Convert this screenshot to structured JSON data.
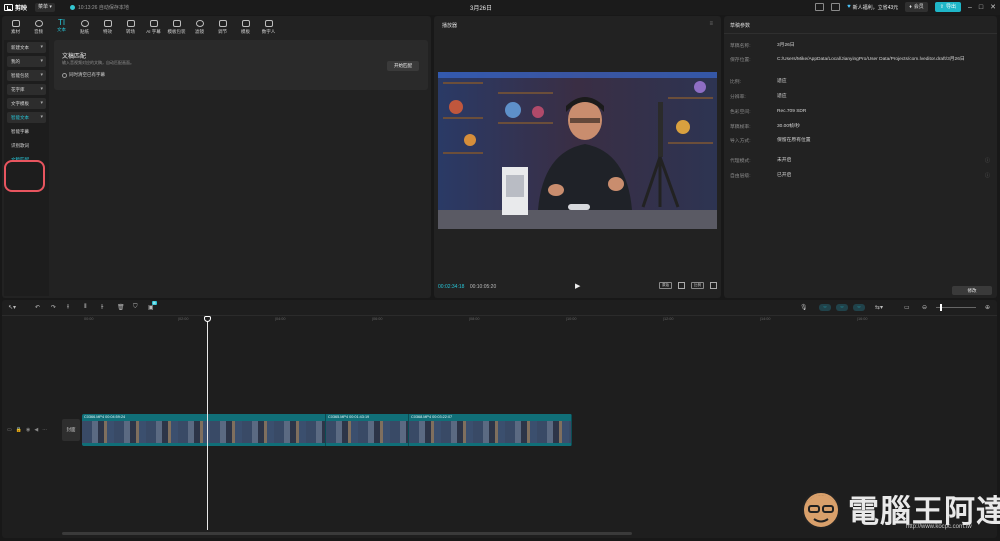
{
  "titlebar": {
    "app_name": "剪映",
    "menu_label": "菜单",
    "autosave": "10:13:26 自动保存本地",
    "doc_title": "3月26日",
    "promo": "新人福利，立省43元",
    "upgrade": "会员",
    "export": "导出"
  },
  "toolbar": {
    "tabs": [
      {
        "label": "素材"
      },
      {
        "label": "音频"
      },
      {
        "label": "文本"
      },
      {
        "label": "贴纸"
      },
      {
        "label": "特效"
      },
      {
        "label": "转场"
      },
      {
        "label": "AI 字幕"
      },
      {
        "label": "模板包装"
      },
      {
        "label": "滤镜"
      },
      {
        "label": "调节"
      },
      {
        "label": "模板"
      },
      {
        "label": "数字人"
      }
    ]
  },
  "left_nav": {
    "items": [
      {
        "label": "新建文本"
      },
      {
        "label": "我的"
      },
      {
        "label": "智能包装"
      },
      {
        "label": "花字库"
      },
      {
        "label": "文字模板"
      },
      {
        "label": "智能文本"
      },
      {
        "label": "智能字幕"
      },
      {
        "label": "识别歌词"
      },
      {
        "label": "文稿匹配"
      }
    ]
  },
  "feature": {
    "title": "文稿匹配",
    "description": "输入音视频对应的文稿，自动匹配画面。",
    "checkbox_label": "同时清空已有字幕",
    "start_button": "开始匹配"
  },
  "player": {
    "title": "播放器",
    "current_time": "00:02:34:18",
    "total_time": "00:10:05:20",
    "ratio_btn": "原始",
    "ratio_btn2": "比例"
  },
  "properties": {
    "title": "草稿参数",
    "rows": [
      {
        "label": "草稿名称:",
        "value": "3月26日"
      },
      {
        "label": "保存位置:",
        "value": "C:/Users/Mike/AppData/Local/JianyingPro/User Data/Projects/com.lveditor.draft/3月26日"
      },
      {
        "label": "比例:",
        "value": "适应"
      },
      {
        "label": "分辨率:",
        "value": "适应"
      },
      {
        "label": "色彩空间:",
        "value": "Rec.709 SDR"
      },
      {
        "label": "草稿帧率:",
        "value": "30.00帧/秒"
      },
      {
        "label": "导入方式:",
        "value": "保留在原有位置"
      },
      {
        "label": "代理模式:",
        "value": "未开启"
      },
      {
        "label": "自由层级:",
        "value": "已开启"
      }
    ],
    "modify_button": "修改"
  },
  "timeline": {
    "ai_badge": "新",
    "ruler_labels": [
      "00:00",
      "|02:00",
      "|04:00",
      "|06:00",
      "|08:00",
      "|10:00",
      "|12:00",
      "|14:00",
      "|16:00"
    ],
    "cover_label": "封面",
    "clips": [
      {
        "label": "C0366.MP4  00:04:59:24"
      },
      {
        "label": "C0365.MP4  00:01:43:19"
      },
      {
        "label": "C0368.MP4  00:03:22:07"
      }
    ]
  },
  "watermark": {
    "text": "電腦王阿達",
    "url": "http://www.kocpc.com.tw"
  },
  "colors": {
    "accent": "#27c4d6",
    "highlight": "#e8555f",
    "clip": "#106f78"
  }
}
